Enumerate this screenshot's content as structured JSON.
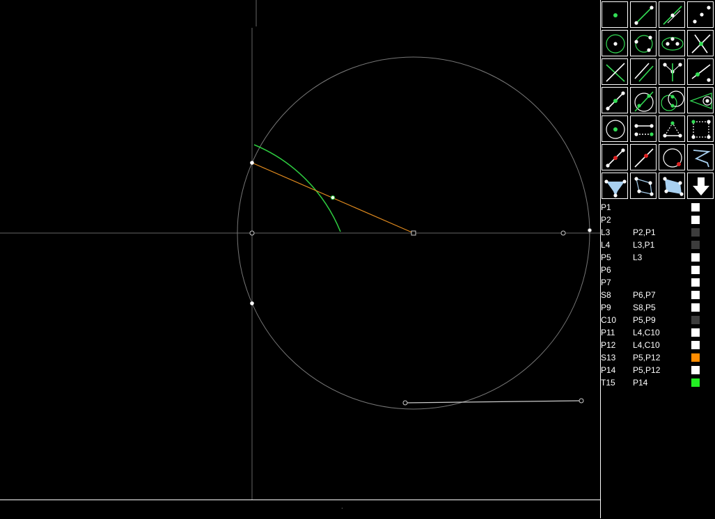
{
  "colors": {
    "background": "#000000",
    "axis": "#555555",
    "circle": "#777777",
    "arc": "#2ecc40",
    "segment": "#e08a1e",
    "tool_green": "#33dd55",
    "tool_red": "#dd2222",
    "tool_blue": "#a8d0f0",
    "swatch_white": "#ffffff",
    "swatch_gray": "#3c3c3c",
    "swatch_orange": "#ff8c00",
    "swatch_green": "#22ee22"
  },
  "toolbar": {
    "tools": [
      {
        "name": "point-tool-icon"
      },
      {
        "name": "line-tool-icon"
      },
      {
        "name": "line-through-point-tool-icon"
      },
      {
        "name": "two-points-tool-icon"
      },
      {
        "name": "circle-center-tool-icon"
      },
      {
        "name": "circle-three-points-tool-icon"
      },
      {
        "name": "ellipse-tool-icon"
      },
      {
        "name": "intersection-tool-icon"
      },
      {
        "name": "perpendicular-tool-icon"
      },
      {
        "name": "parallel-tool-icon"
      },
      {
        "name": "angle-bisector-tool-icon"
      },
      {
        "name": "line-point-tool-icon"
      },
      {
        "name": "midpoint-tool-icon"
      },
      {
        "name": "circle-line-tool-icon"
      },
      {
        "name": "circle-circle-tool-icon"
      },
      {
        "name": "tangent-tool-icon"
      },
      {
        "name": "circle-point-tool-icon"
      },
      {
        "name": "segment-length-tool-icon"
      },
      {
        "name": "triangle-tool-icon"
      },
      {
        "name": "rectangle-tool-icon"
      },
      {
        "name": "point-on-segment-tool-icon"
      },
      {
        "name": "point-on-line-tool-icon"
      },
      {
        "name": "point-on-circle-tool-icon"
      },
      {
        "name": "curve-tool-icon"
      },
      {
        "name": "cone-tool-icon"
      },
      {
        "name": "polyline-tool-icon"
      },
      {
        "name": "polygon-tool-icon"
      },
      {
        "name": "download-arrow-icon"
      }
    ]
  },
  "objects": [
    {
      "name": "P1",
      "deps": "",
      "swatch": "#ffffff"
    },
    {
      "name": "P2",
      "deps": "",
      "swatch": "#ffffff"
    },
    {
      "name": "L3",
      "deps": "P2,P1",
      "swatch": "#3c3c3c"
    },
    {
      "name": "L4",
      "deps": "L3,P1",
      "swatch": "#3c3c3c"
    },
    {
      "name": "P5",
      "deps": "L3",
      "swatch": "#ffffff"
    },
    {
      "name": "P6",
      "deps": "",
      "swatch": "#ffffff"
    },
    {
      "name": "P7",
      "deps": "",
      "swatch": "#ffffff"
    },
    {
      "name": "S8",
      "deps": "P6,P7",
      "swatch": "#ffffff"
    },
    {
      "name": "P9",
      "deps": "S8,P5",
      "swatch": "#ffffff"
    },
    {
      "name": "C10",
      "deps": "P5,P9",
      "swatch": "#3c3c3c"
    },
    {
      "name": "P11",
      "deps": "L4,C10",
      "swatch": "#ffffff"
    },
    {
      "name": "P12",
      "deps": "L4,C10",
      "swatch": "#ffffff"
    },
    {
      "name": "S13",
      "deps": "P5,P12",
      "swatch": "#ff8c00"
    },
    {
      "name": "P14",
      "deps": "P5,P12",
      "swatch": "#ffffff"
    },
    {
      "name": "T15",
      "deps": "P14",
      "swatch": "#22ee22"
    }
  ],
  "cmdline": {
    "text": "."
  }
}
